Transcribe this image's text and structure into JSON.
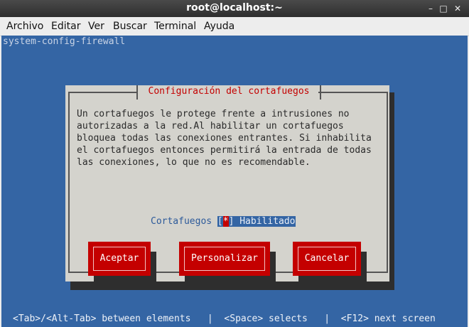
{
  "window": {
    "title": "root@localhost:~",
    "minimize_glyph": "–",
    "maximize_glyph": "□",
    "close_glyph": "✕"
  },
  "menu": [
    "Archivo",
    "Editar",
    "Ver",
    "Buscar",
    "Terminal",
    "Ayuda"
  ],
  "terminal": {
    "command": "system-config-firewall",
    "background": "#3465a4"
  },
  "dialog": {
    "title": "Configuración del cortafuegos",
    "description": "Un cortafuegos le protege frente a intrusiones no\nautorizadas a la red.Al habilitar un cortafuegos\nbloquea todas las conexiones entrantes. Si inhabilita\nel cortafuegos entonces permitirá la entrada de todas\nlas conexiones, lo que no es recomendable.",
    "firewall_label": "Cortafuegos",
    "checkbox_open": "[",
    "checkbox_mark": "*",
    "checkbox_close": "]",
    "checkbox_state": "Habilitado",
    "buttons": {
      "accept": "Aceptar",
      "customize": "Personalizar",
      "cancel": "Cancelar"
    }
  },
  "hint_bar": "<Tab>/<Alt-Tab> between elements   |  <Space> selects   |  <F12> next screen",
  "colors": {
    "accent": "#c40000",
    "dialog_bg": "#d4d3cd",
    "terminal_bg": "#3465a4"
  }
}
